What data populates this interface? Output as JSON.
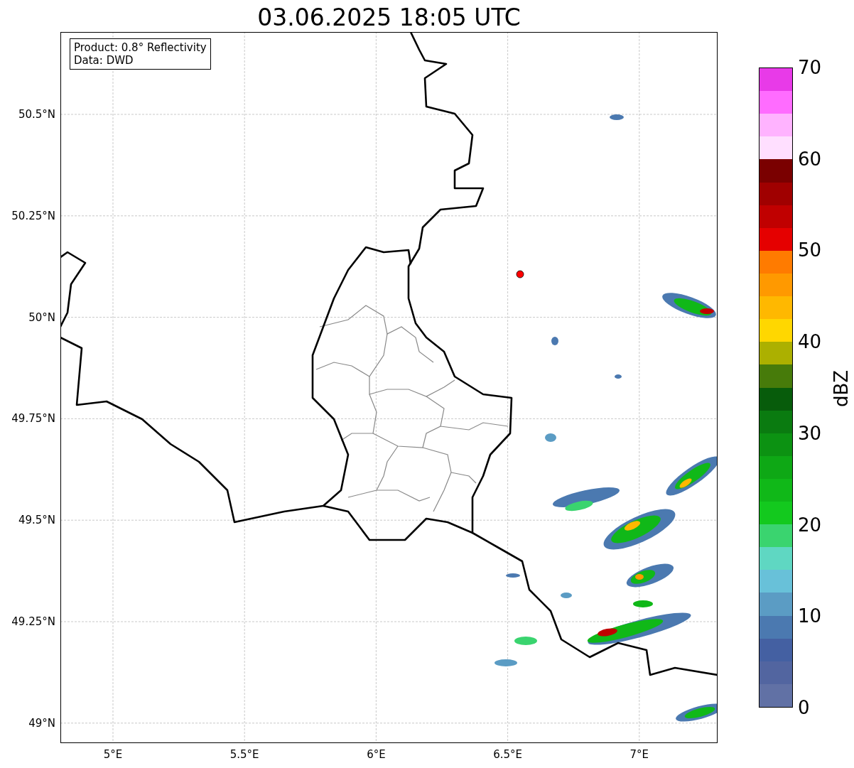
{
  "title": "03.06.2025 18:05 UTC",
  "info_box": [
    "Product: 0.8° Reflectivity",
    "Data: DWD"
  ],
  "lat_ticks": [
    "50.5°N",
    "50.25°N",
    "50°N",
    "49.75°N",
    "49.5°N",
    "49.25°N",
    "49°N"
  ],
  "lon_ticks": [
    "5°E",
    "5.5°E",
    "6°E",
    "6.5°E",
    "7°E"
  ],
  "colorbar": {
    "label": "dBZ",
    "ticks": [
      "70",
      "60",
      "50",
      "40",
      "30",
      "20",
      "10",
      "0"
    ],
    "bins": [
      {
        "color": "#e83ae8"
      },
      {
        "color": "#ff6cff"
      },
      {
        "color": "#ffb3ff"
      },
      {
        "color": "#ffdfff"
      },
      {
        "color": "#7a0000"
      },
      {
        "color": "#a00000"
      },
      {
        "color": "#c00000"
      },
      {
        "color": "#e50000"
      },
      {
        "color": "#ff7b00"
      },
      {
        "color": "#ff9900"
      },
      {
        "color": "#ffb800"
      },
      {
        "color": "#ffd700"
      },
      {
        "color": "#acb000"
      },
      {
        "color": "#477b0a"
      },
      {
        "color": "#075c0b"
      },
      {
        "color": "#0a7b10"
      },
      {
        "color": "#0c9212"
      },
      {
        "color": "#0ea815"
      },
      {
        "color": "#10b818"
      },
      {
        "color": "#13c91e"
      },
      {
        "color": "#3ad46f"
      },
      {
        "color": "#5fd7c2"
      },
      {
        "color": "#68c1d9"
      },
      {
        "color": "#5b9cc4"
      },
      {
        "color": "#4b79b0"
      },
      {
        "color": "#4460a2"
      },
      {
        "color": "#5265a0"
      },
      {
        "color": "#6171a5"
      }
    ]
  }
}
